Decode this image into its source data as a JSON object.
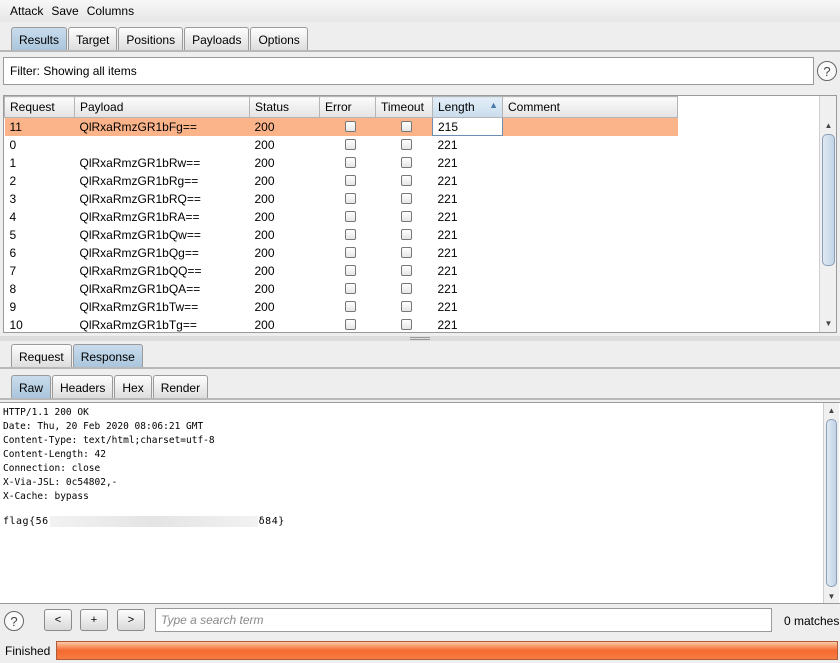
{
  "menu": [
    "Attack",
    "Save",
    "Columns"
  ],
  "top_tabs": {
    "items": [
      "Results",
      "Target",
      "Positions",
      "Payloads",
      "Options"
    ],
    "active": "Results"
  },
  "filter": {
    "text": "Filter: Showing all items"
  },
  "results_table": {
    "columns": [
      "Request",
      "Payload",
      "Status",
      "Error",
      "Timeout",
      "Length",
      "Comment"
    ],
    "sorted_column": "Length",
    "rows": [
      {
        "request": "11",
        "payload": "QlRxaRmzGR1bFg==",
        "status": "200",
        "length": "215",
        "selected": true
      },
      {
        "request": "0",
        "payload": "",
        "status": "200",
        "length": "221"
      },
      {
        "request": "1",
        "payload": "QlRxaRmzGR1bRw==",
        "status": "200",
        "length": "221"
      },
      {
        "request": "2",
        "payload": "QlRxaRmzGR1bRg==",
        "status": "200",
        "length": "221"
      },
      {
        "request": "3",
        "payload": "QlRxaRmzGR1bRQ==",
        "status": "200",
        "length": "221"
      },
      {
        "request": "4",
        "payload": "QlRxaRmzGR1bRA==",
        "status": "200",
        "length": "221"
      },
      {
        "request": "5",
        "payload": "QlRxaRmzGR1bQw==",
        "status": "200",
        "length": "221"
      },
      {
        "request": "6",
        "payload": "QlRxaRmzGR1bQg==",
        "status": "200",
        "length": "221"
      },
      {
        "request": "7",
        "payload": "QlRxaRmzGR1bQQ==",
        "status": "200",
        "length": "221"
      },
      {
        "request": "8",
        "payload": "QlRxaRmzGR1bQA==",
        "status": "200",
        "length": "221"
      },
      {
        "request": "9",
        "payload": "QlRxaRmzGR1bTw==",
        "status": "200",
        "length": "221"
      },
      {
        "request": "10",
        "payload": "QlRxaRmzGR1bTg==",
        "status": "200",
        "length": "221"
      }
    ]
  },
  "detail_tabs": {
    "items": [
      "Request",
      "Response"
    ],
    "active": "Response"
  },
  "view_tabs": {
    "items": [
      "Raw",
      "Headers",
      "Hex",
      "Render"
    ],
    "active": "Raw"
  },
  "response": {
    "lines": [
      "HTTP/1.1 200 OK",
      "Date: Thu, 20 Feb 2020 08:06:21 GMT",
      "Content-Type: text/html;charset=utf-8",
      "Content-Length: 42",
      "Connection: close",
      "X-Via-JSL: 0c54802,-",
      "X-Cache: bypass"
    ],
    "flag_prefix": "flag{56",
    "flag_suffix": "δ84}"
  },
  "search": {
    "placeholder": "Type a search term",
    "matches": "0 matches",
    "buttons": [
      "<",
      "+",
      ">"
    ]
  },
  "footer": {
    "status": "Finished",
    "progress_fraction": 1.0
  },
  "colors": {
    "selected_row": "#fbb48a",
    "active_tab": "#b7cde1",
    "progress": "#f46a30"
  },
  "icons": {
    "help": "?"
  }
}
